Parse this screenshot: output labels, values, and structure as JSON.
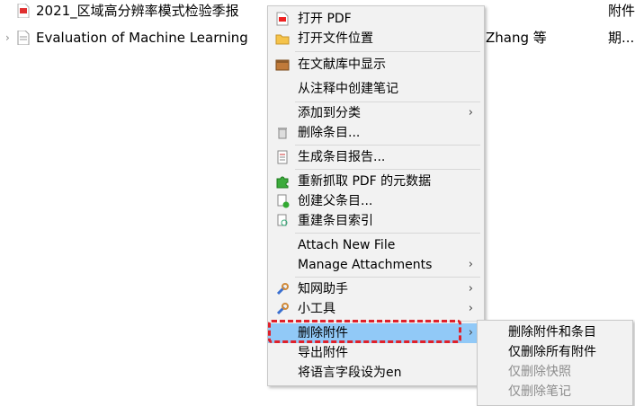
{
  "list": {
    "rows": [
      {
        "title": "2021_区域高分辨率模式检验季报",
        "creator": "",
        "right": "附件"
      },
      {
        "title": "Evaluation of Machine Learning",
        "creator": "Zhang 等",
        "right": "期..."
      }
    ]
  },
  "context_menu": {
    "items": [
      {
        "label": "打开 PDF",
        "icon": "pdf-icon"
      },
      {
        "label": "打开文件位置",
        "icon": "folder-icon"
      },
      {
        "label": "在文献库中显示",
        "icon": "library-icon"
      },
      {
        "label": "从注释中创建笔记",
        "icon": ""
      },
      {
        "label": "添加到分类",
        "icon": "",
        "submenu": true
      },
      {
        "label": "删除条目...",
        "icon": "trash-icon"
      },
      {
        "label": "生成条目报告...",
        "icon": "report-icon"
      },
      {
        "label": "重新抓取 PDF 的元数据",
        "icon": "puzzle-icon"
      },
      {
        "label": "创建父条目...",
        "icon": "new-parent-icon"
      },
      {
        "label": "重建条目索引",
        "icon": "reindex-icon"
      },
      {
        "label": "Attach New File",
        "icon": ""
      },
      {
        "label": "Manage Attachments",
        "icon": "",
        "submenu": true
      },
      {
        "label": "知网助手",
        "icon": "wrench-icon",
        "submenu": true
      },
      {
        "label": "小工具",
        "icon": "wrench-icon",
        "submenu": true
      },
      {
        "label": "删除附件",
        "icon": "",
        "submenu": true,
        "highlighted": true
      },
      {
        "label": "导出附件",
        "icon": ""
      },
      {
        "label": "将语言字段设为en",
        "icon": ""
      }
    ],
    "submenu_arrow": "›"
  },
  "submenu": {
    "items": [
      {
        "label": "删除附件和条目",
        "enabled": true
      },
      {
        "label": "仅删除所有附件",
        "enabled": true
      },
      {
        "label": "仅删除快照",
        "enabled": false
      },
      {
        "label": "仅删除笔记",
        "enabled": false
      }
    ]
  },
  "colors": {
    "highlight": "#91c9f7",
    "annotation_outline": "#e0202a",
    "menu_bg": "#f2f2f2"
  }
}
